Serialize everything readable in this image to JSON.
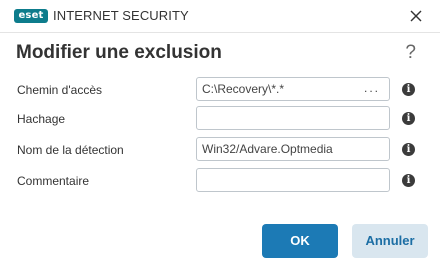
{
  "window": {
    "brand_logo": "eset",
    "app_title": "INTERNET SECURITY",
    "close_icon": "close-icon"
  },
  "dialog": {
    "heading": "Modifier une exclusion",
    "help_glyph": "?"
  },
  "fields": [
    {
      "label": "Chemin d'accès",
      "value": "C:\\Recovery\\*.*",
      "browse_label": "...",
      "info_icon": "info-icon"
    },
    {
      "label": "Hachage",
      "value": "",
      "info_icon": "info-icon"
    },
    {
      "label": "Nom de la détection",
      "value": "Win32/Advare.Optmedia",
      "info_icon": "info-icon"
    },
    {
      "label": "Commentaire",
      "value": "",
      "info_icon": "info-icon"
    }
  ],
  "buttons": {
    "ok_label": "OK",
    "cancel_label": "Annuler"
  },
  "colors": {
    "brand": "#0d7c8c",
    "primary_button": "#1c7ab5",
    "secondary_button": "#d9e6ef"
  }
}
